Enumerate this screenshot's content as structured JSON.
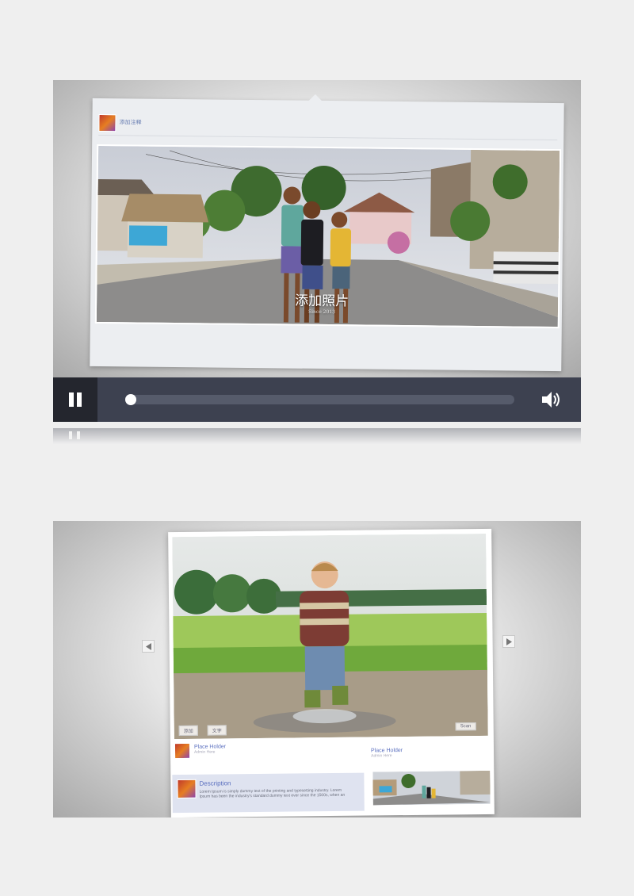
{
  "player_card": {
    "user_name": "添加注释",
    "photo_caption": "添加照片",
    "photo_caption_sub": "Since 2013"
  },
  "controls": {
    "progress_fraction": 0.0,
    "pause_icon": "pause-icon",
    "volume_icon": "volume-icon"
  },
  "gallery_card": {
    "photo_buttons": [
      "添加",
      "文字"
    ],
    "scan_button": "Scan",
    "left": {
      "title": "Place Holder",
      "subtitle": "Admin Here"
    },
    "right": {
      "title": "Place Holder",
      "subtitle": "Admin Here"
    },
    "description": {
      "title": "Description",
      "body": "Lorem Ipsum is simply dummy text of the printing and typesetting industry. Lorem Ipsum has been the industry's standard dummy text ever since the 1500s, when an"
    }
  },
  "colors": {
    "control_bar": "#3d4150",
    "accent_text": "#5a6fbf"
  }
}
